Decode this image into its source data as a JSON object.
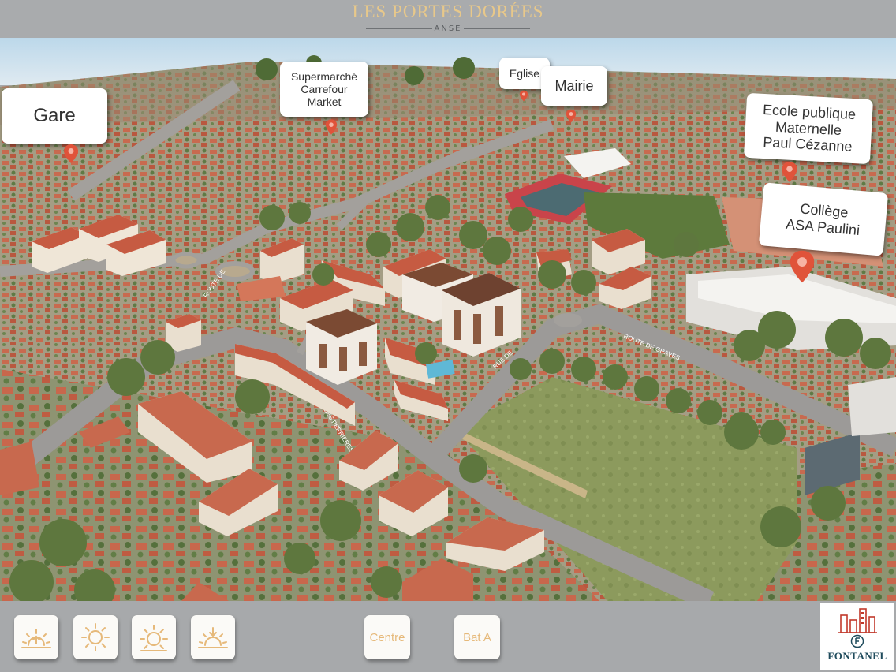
{
  "header": {
    "brand": "LES PORTES DORÉES",
    "sub": "ANSE"
  },
  "map": {
    "labels": [
      {
        "id": "gare",
        "lines": [
          "Gare"
        ]
      },
      {
        "id": "supermarche",
        "lines": [
          "Supermarché",
          "Carrefour",
          "Market"
        ]
      },
      {
        "id": "eglise",
        "lines": [
          "Eglise"
        ]
      },
      {
        "id": "mairie",
        "lines": [
          "Mairie"
        ]
      },
      {
        "id": "ecole",
        "lines": [
          "Ecole publique",
          "Maternelle",
          "Paul Cézanne"
        ]
      },
      {
        "id": "college",
        "lines": [
          "Collège",
          "ASA Paulini"
        ]
      }
    ],
    "pin_color": "#e0533a",
    "street_labels": [
      "ROUTE DE",
      "RUE DES PERRIERES",
      "ROUTE DE GRAVES",
      "RUE DE"
    ]
  },
  "footer": {
    "buttons": [
      {
        "id": "sunrise",
        "icon": "sunrise-icon"
      },
      {
        "id": "sun-morning",
        "icon": "sun-icon"
      },
      {
        "id": "sun-afternoon",
        "icon": "sun-icon"
      },
      {
        "id": "sunset",
        "icon": "sunset-icon"
      }
    ],
    "centre_label": "Centre",
    "bat_a_label": "Bat A",
    "logo_text": "FONTANEL",
    "icon_color": "#e6b97a"
  }
}
